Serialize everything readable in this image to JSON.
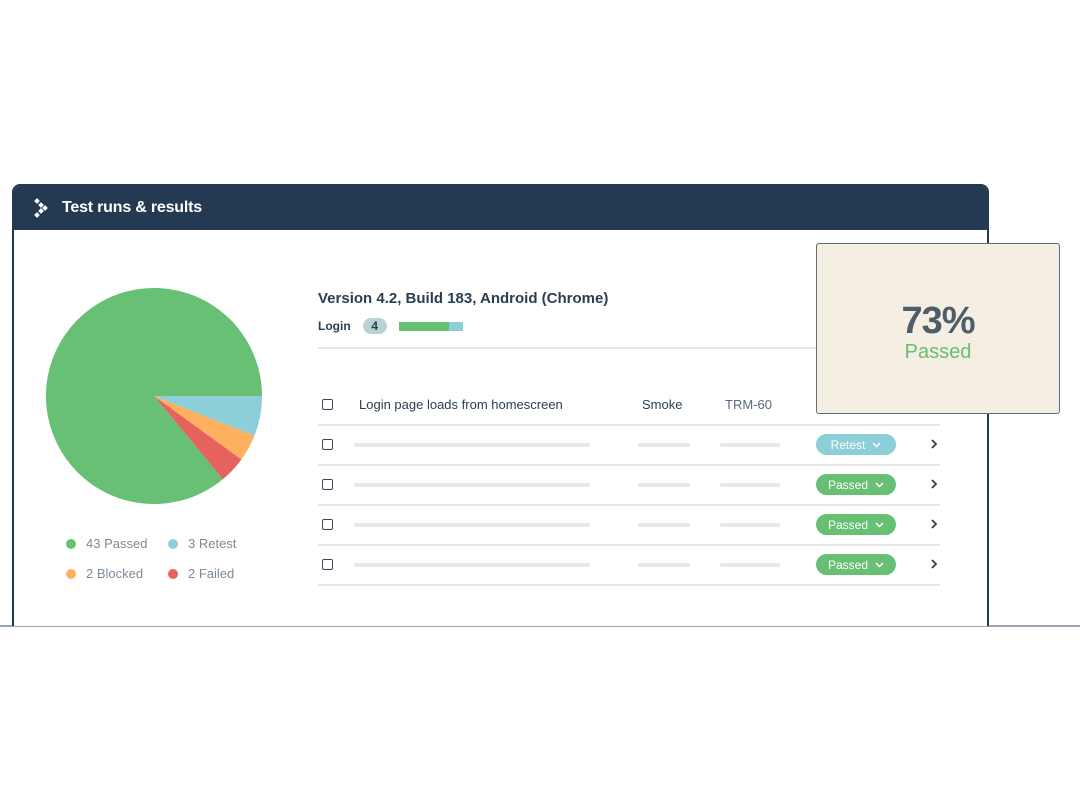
{
  "header": {
    "title": "Test runs & results",
    "icon": "brand-chevron-icon"
  },
  "colors": {
    "header_bg": "#243a52",
    "passed": "#67c073",
    "retest": "#8ccfd9",
    "blocked": "#ffb05e",
    "failed": "#e5625f"
  },
  "chart_data": {
    "type": "pie",
    "slices": [
      {
        "name": "Passed",
        "value": 43,
        "color": "#67c073"
      },
      {
        "name": "Retest",
        "value": 3,
        "color": "#8ccfd9"
      },
      {
        "name": "Blocked",
        "value": 2,
        "color": "#ffb05e"
      },
      {
        "name": "Failed",
        "value": 2,
        "color": "#e5625f"
      }
    ],
    "legend": [
      "43 Passed",
      "3 Retest",
      "2 Blocked",
      "2 Failed"
    ]
  },
  "run": {
    "title": "Version 4.2, Build 183, Android (Chrome)",
    "section_label": "Login",
    "section_count": "4",
    "section_passed_fraction": 0.78
  },
  "table": {
    "first_row": {
      "name": "Login page loads from homescreen",
      "type": "Smoke",
      "id": "TRM-60"
    },
    "rows": [
      {
        "status": "Retest",
        "status_color": "#8ccfd9"
      },
      {
        "status": "Passed",
        "status_color": "#67c073"
      },
      {
        "status": "Passed",
        "status_color": "#67c073"
      },
      {
        "status": "Passed",
        "status_color": "#67c073"
      }
    ]
  },
  "summary": {
    "value": "73%",
    "label": "Passed"
  }
}
